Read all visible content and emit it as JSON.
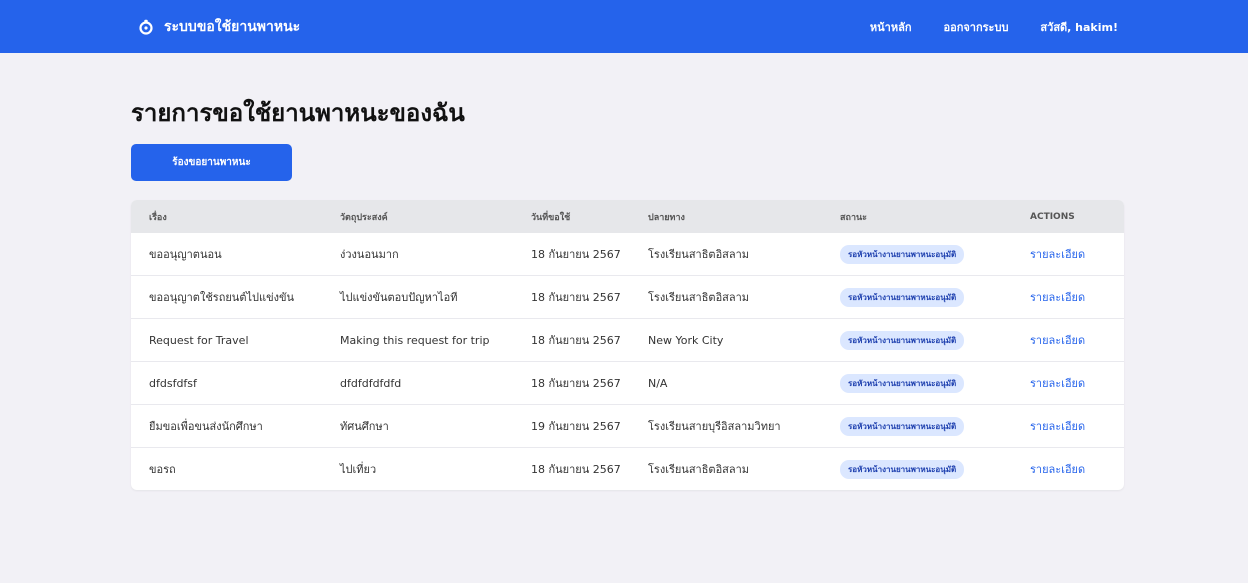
{
  "header": {
    "brand": "ระบบขอใช้ยานพาหนะ",
    "nav": [
      "หน้าหลัก",
      "ออกจากระบบ",
      "สวัสดี, hakim!"
    ]
  },
  "page": {
    "title": "รายการขอใช้ยานพาหนะของฉัน",
    "new_button": "ร้องขอยานพาหนะ"
  },
  "table": {
    "columns": [
      "เรื่อง",
      "วัตถุประสงค์",
      "วันที่ขอใช้",
      "ปลายทาง",
      "สถานะ",
      "ACTIONS"
    ],
    "rows": [
      {
        "subject": "ขออนุญาตนอน",
        "purpose": "ง่วงนอนมาก",
        "date": "18 กันยายน 2567",
        "destination": "โรงเรียนสาธิตอิสลาม",
        "status": "รอหัวหน้างานยานพาหนะอนุมัติ",
        "action": "รายละเอียด"
      },
      {
        "subject": "ขออนุญาตใช้รถยนต์ไปแข่งขัน",
        "purpose": "ไปแข่งขันตอบปัญหาไอที",
        "date": "18 กันยายน 2567",
        "destination": "โรงเรียนสาธิตอิสลาม",
        "status": "รอหัวหน้างานยานพาหนะอนุมัติ",
        "action": "รายละเอียด"
      },
      {
        "subject": "Request for Travel",
        "purpose": "Making this request for trip",
        "date": "18 กันยายน 2567",
        "destination": "New York City",
        "status": "รอหัวหน้างานยานพาหนะอนุมัติ",
        "action": "รายละเอียด"
      },
      {
        "subject": "dfdsfdfsf",
        "purpose": "dfdfdfdfdfd",
        "date": "18 กันยายน 2567",
        "destination": "N/A",
        "status": "รอหัวหน้างานยานพาหนะอนุมัติ",
        "action": "รายละเอียด"
      },
      {
        "subject": "ยืมขอเพื่อขนส่งนักศึกษา",
        "purpose": "ทัศนศึกษา",
        "date": "19 กันยายน 2567",
        "destination": "โรงเรียนสายบุรีอิสลามวิทยา",
        "status": "รอหัวหน้างานยานพาหนะอนุมัติ",
        "action": "รายละเอียด"
      },
      {
        "subject": "ขอรถ",
        "purpose": "ไปเที่ยว",
        "date": "18 กันยายน 2567",
        "destination": "โรงเรียนสาธิตอิสลาม",
        "status": "รอหัวหน้างานยานพาหนะอนุมัติ",
        "action": "รายละเอียด"
      }
    ]
  },
  "colors": {
    "primary": "#2563eb",
    "badge_bg": "#dbe7ff",
    "badge_text": "#1e40af",
    "background": "#f2f1f6"
  },
  "icons": {
    "brand": "car-wheel-icon"
  }
}
